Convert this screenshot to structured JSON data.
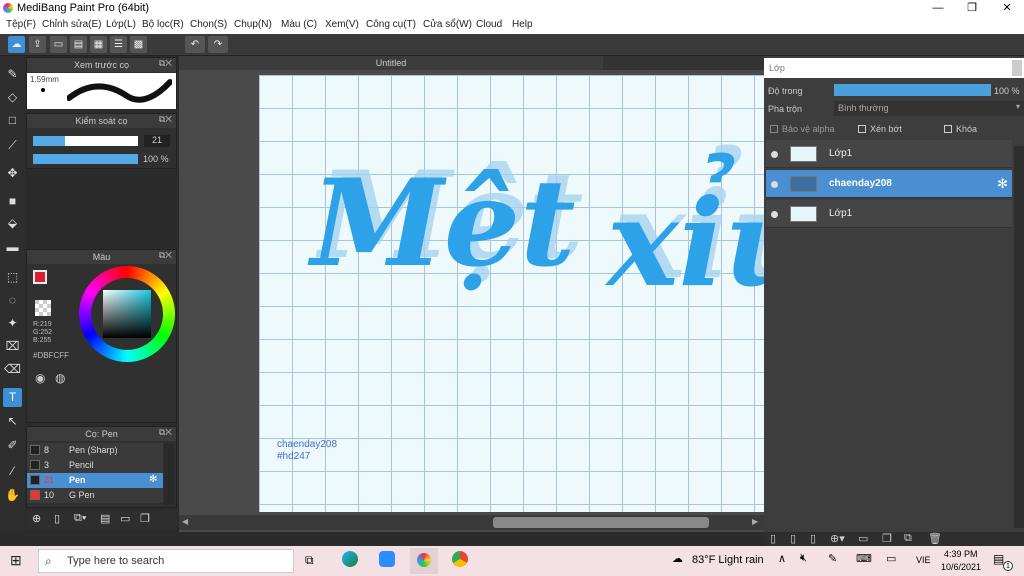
{
  "app": {
    "title": "MediBang Paint Pro (64bit)",
    "min": "—",
    "max": "❐",
    "close": "✕"
  },
  "menu": [
    "Tệp(F)",
    "Chỉnh sửa(E)",
    "Lớp(L)",
    "Bộ lọc(R)",
    "Chọn(S)",
    "Chụp(N)",
    "Màu (C)",
    "Xem(V)",
    "Công cụ(T)",
    "Cửa sổ(W)",
    "Cloud",
    "Help"
  ],
  "document": {
    "tab": "Untitled",
    "credit1": "chaenday208",
    "credit2": "#hd247",
    "art_text_1": "Mệt",
    "art_text_2": "xỉu"
  },
  "preview_panel": {
    "title": "Xem trước cọ",
    "size": "1.59mm"
  },
  "brush_ctrl": {
    "title": "Kiểm soát cọ",
    "size_value": "21",
    "opacity_value": "100 %",
    "size_fraction": 0.3,
    "opacity_fraction": 1.0
  },
  "color_panel": {
    "title": "Màu",
    "r": "R:219",
    "g": "G:252",
    "b": "B:255",
    "hex": "#DBFCFF"
  },
  "brush_panel": {
    "title": "Cọ: Pen",
    "items": [
      {
        "num": "8",
        "name": "Pen (Sharp)"
      },
      {
        "num": "3",
        "name": "Pencil"
      },
      {
        "num": "21",
        "name": "Pen"
      },
      {
        "num": "10",
        "name": "G Pen"
      }
    ]
  },
  "layer_panel": {
    "title": "Lớp",
    "opacity_label": "Độ trong",
    "opacity_value": "100 %",
    "blend_label": "Pha trộn",
    "blend_value": "Bình thường",
    "protect_alpha": "Bảo vệ alpha",
    "clip": "Xén bớt",
    "lock": "Khóa",
    "layers": [
      {
        "name": "Lớp1"
      },
      {
        "name": "chaenday208"
      },
      {
        "name": "Lớp1"
      }
    ]
  },
  "taskbar": {
    "search_placeholder": "Type here to search",
    "weather": "83°F  Light rain",
    "lang": "VIE",
    "time": "4:39 PM",
    "date": "10/6/2021",
    "notif": "1"
  },
  "colors": {
    "accent": "#3d8fd6",
    "fg_color": "#db1f2f",
    "text_blue": "#2ea2e8"
  }
}
